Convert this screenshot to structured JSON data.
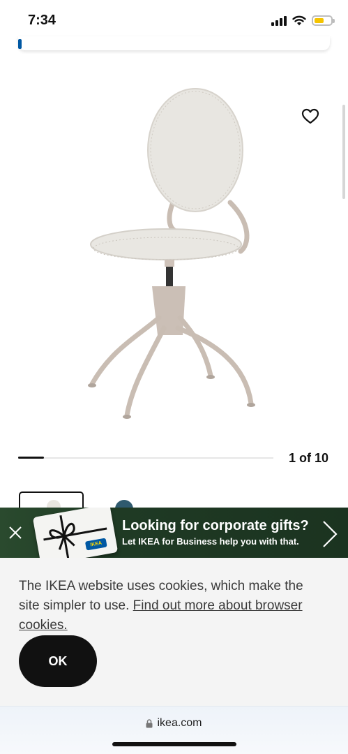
{
  "status_bar": {
    "time": "7:34",
    "icons": [
      "signal-icon",
      "wifi-icon",
      "battery-icon"
    ],
    "battery_color": "#f5c400"
  },
  "product": {
    "image_alt_icon": "office-chair-image",
    "favorite_icon": "heart-outline-icon"
  },
  "gallery": {
    "counter": "1 of 10",
    "progress": 0.1
  },
  "promo_banner": {
    "title": "Looking for corporate gifts?",
    "subtitle": "Let IKEA for Business help you with that.",
    "gift_card_logo": "IKEA",
    "close_icon": "close-icon",
    "next_icon": "chevron-right-icon",
    "background": "#1c3420"
  },
  "cookie_banner": {
    "text_before_link": "The IKEA website uses cookies, which make the site simpler to use. ",
    "link_text": "Find out more about browser cookies.",
    "ok_label": "OK"
  },
  "browser": {
    "url": "ikea.com",
    "lock_icon": "lock-icon"
  },
  "colors": {
    "ikea_blue": "#0058a3",
    "ikea_yellow": "#ffdb00",
    "button_black": "#111111"
  }
}
